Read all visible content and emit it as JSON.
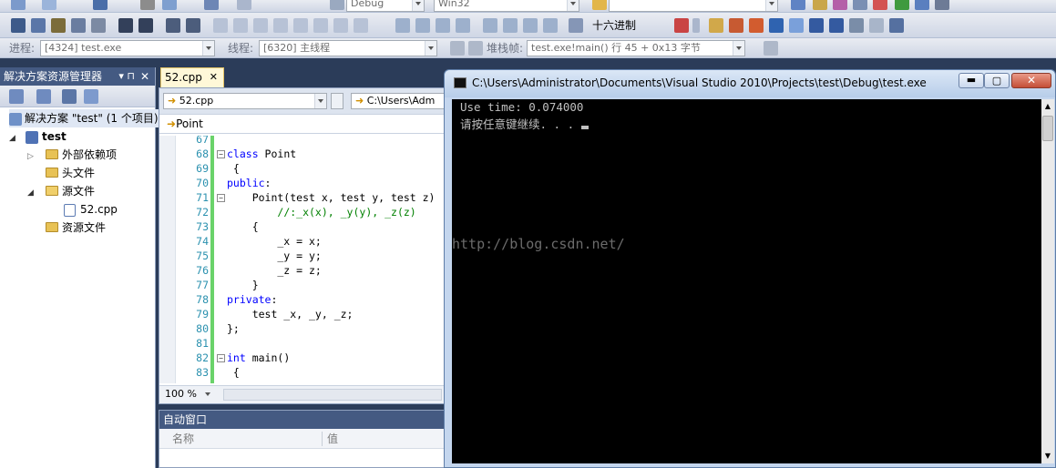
{
  "toolbar": {
    "config_dropdown": "Debug",
    "platform_dropdown": "Win32",
    "hex_label": "十六进制"
  },
  "debug_bar": {
    "process_label": "进程:",
    "process_value": "[4324] test.exe",
    "thread_label": "线程:",
    "thread_value": "[6320] 主线程",
    "stack_label": "堆栈帧:",
    "stack_value": "test.exe!main()  行 45 + 0x13 字节"
  },
  "solution_explorer": {
    "title": "解决方案资源管理器",
    "solution_label": "解决方案 \"test\" (1 个项目)",
    "project": "test",
    "items": [
      {
        "label": "外部依赖项",
        "type": "folder-expandable"
      },
      {
        "label": "头文件",
        "type": "folder"
      },
      {
        "label": "源文件",
        "type": "folder-open"
      },
      {
        "label": "52.cpp",
        "type": "file"
      },
      {
        "label": "资源文件",
        "type": "folder"
      }
    ]
  },
  "editor": {
    "tab_label": "52.cpp",
    "file_dropdown": "52.cpp",
    "path_dropdown": "C:\\Users\\Adm",
    "member_label": "Point",
    "zoom": "100 %",
    "lines": [
      {
        "n": "67",
        "text": ""
      },
      {
        "n": "68",
        "text": "class Point"
      },
      {
        "n": "69",
        "text": " {"
      },
      {
        "n": "70",
        "text": "public:"
      },
      {
        "n": "71",
        "text": "    Point(test x, test y, test z)"
      },
      {
        "n": "72",
        "text": "        //:_x(x), _y(y), _z(z)"
      },
      {
        "n": "73",
        "text": "    {"
      },
      {
        "n": "74",
        "text": "        _x = x;"
      },
      {
        "n": "75",
        "text": "        _y = y;"
      },
      {
        "n": "76",
        "text": "        _z = z;"
      },
      {
        "n": "77",
        "text": "    }"
      },
      {
        "n": "78",
        "text": "private:"
      },
      {
        "n": "79",
        "text": "    test _x, _y, _z;"
      },
      {
        "n": "80",
        "text": "};"
      },
      {
        "n": "81",
        "text": ""
      },
      {
        "n": "82",
        "text": "int main()"
      },
      {
        "n": "83",
        "text": " {"
      }
    ]
  },
  "auto_window": {
    "title": "自动窗口",
    "col_name": "名称",
    "col_value": "值"
  },
  "console": {
    "title": "C:\\Users\\Administrator\\Documents\\Visual Studio 2010\\Projects\\test\\Debug\\test.exe",
    "line1": "Use time: 0.074000",
    "line2": "请按任意键继续. . . ",
    "watermark": "http://blog.csdn.net/"
  },
  "colors": {
    "ide_bg": "#2b3c59",
    "console_bg": "#000000",
    "console_text": "#c0c0c0",
    "keyword": "#0000ff",
    "comment": "#008000",
    "line_number": "#2b91af"
  }
}
